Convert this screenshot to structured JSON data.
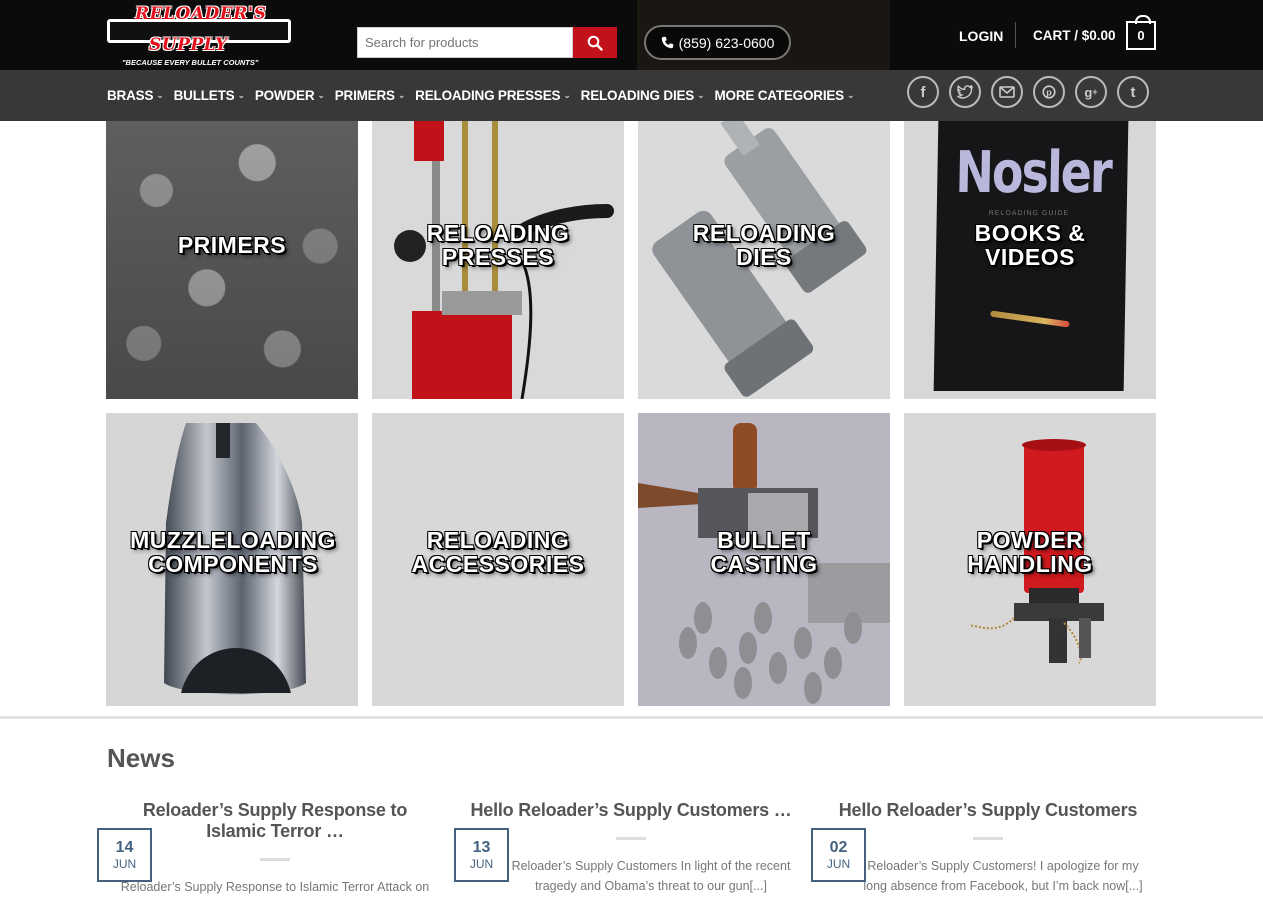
{
  "header": {
    "logo": {
      "line1": "RELOADER'S",
      "line2": "SUPPLY",
      "tagline": "\"BECAUSE EVERY BULLET COUNTS\""
    },
    "search": {
      "placeholder": "Search for products"
    },
    "phone": "(859) 623-0600",
    "login_label": "LOGIN",
    "cart_label": "CART / $0.00",
    "cart_count": "0"
  },
  "nav": {
    "items": [
      {
        "label": "BRASS"
      },
      {
        "label": "BULLETS"
      },
      {
        "label": "POWDER"
      },
      {
        "label": "PRIMERS"
      },
      {
        "label": "RELOADING PRESSES"
      },
      {
        "label": "RELOADING DIES"
      },
      {
        "label": "MORE CATEGORIES"
      }
    ]
  },
  "social": [
    "facebook",
    "twitter",
    "email",
    "pinterest",
    "google-plus",
    "tumblr"
  ],
  "categories": [
    {
      "line1": "PRIMERS",
      "line2": ""
    },
    {
      "line1": "RELOADING",
      "line2": "PRESSES"
    },
    {
      "line1": "RELOADING",
      "line2": "DIES"
    },
    {
      "line1": "BOOKS &",
      "line2": "VIDEOS"
    },
    {
      "line1": "MUZZLELOADING",
      "line2": "COMPONENTS"
    },
    {
      "line1": "RELOADING",
      "line2": "ACCESSORIES"
    },
    {
      "line1": "BULLET",
      "line2": "CASTING"
    },
    {
      "line1": "POWDER",
      "line2": "HANDLING"
    }
  ],
  "books_cover": {
    "brand": "Nosler",
    "subtitle": "RELOADING GUIDE"
  },
  "news": {
    "heading": "News",
    "posts": [
      {
        "title": "Reloader’s Supply Response to Islamic Terror …",
        "day": "14",
        "month": "JUN",
        "excerpt": "Reloader’s Supply Response to Islamic Terror Attack on"
      },
      {
        "title": "Hello Reloader’s Supply Customers …",
        "day": "13",
        "month": "JUN",
        "excerpt_line1": "Reloader’s Supply Customers In light of the recent",
        "excerpt_line2": "tragedy and Obama’s threat to our gun[...]"
      },
      {
        "title": "Hello Reloader’s Supply Customers",
        "day": "02",
        "month": "JUN",
        "excerpt_line1": "Reloader’s Supply Customers! I apologize for my",
        "excerpt_line2": "long absence from Facebook, but I’m back now[...]"
      }
    ]
  },
  "colors": {
    "brand_red": "#c3111b",
    "date_blue": "#44627f",
    "header_black": "#0b0b0b"
  }
}
